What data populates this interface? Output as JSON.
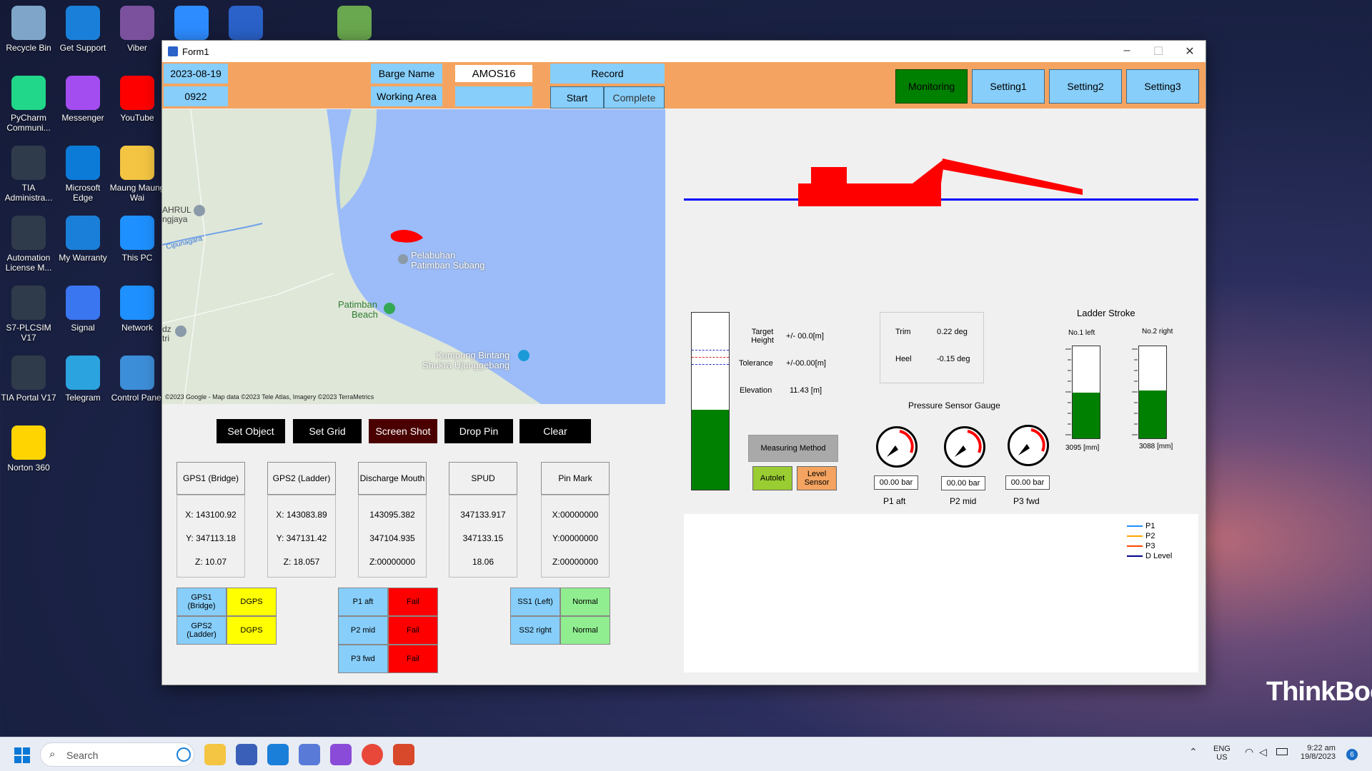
{
  "desktop": {
    "icons": [
      {
        "label": "Recycle Bin",
        "icon": "recycle-bin-icon",
        "color": "#7fa6c8"
      },
      {
        "label": "Get Support",
        "icon": "get-support-icon",
        "color": "#1a7fd8"
      },
      {
        "label": "Viber",
        "icon": "viber-icon",
        "color": "#7b519d"
      },
      {
        "label": "zoom",
        "icon": "zoom-icon",
        "color": "#2d8cff"
      },
      {
        "label": "",
        "icon": "network-tool-icon",
        "color": "#2a62c9"
      },
      {
        "label": "",
        "icon": "notepad-image-icon",
        "color": "#6aa84f"
      },
      {
        "label": "PyCharm Communi...",
        "icon": "pycharm-icon",
        "color": "#21d789"
      },
      {
        "label": "Messenger",
        "icon": "messenger-icon",
        "color": "#a34df0"
      },
      {
        "label": "YouTube",
        "icon": "youtube-icon",
        "color": "#ff0000"
      },
      {
        "label": "TIA Administra...",
        "icon": "tia-admin-icon",
        "color": "#2f3b4a"
      },
      {
        "label": "Microsoft Edge",
        "icon": "edge-icon",
        "color": "#0c7bd8"
      },
      {
        "label": "Maung Maung Wai",
        "icon": "folder-icon",
        "color": "#f4c542"
      },
      {
        "label": "Automation License M...",
        "icon": "license-manager-icon",
        "color": "#2f3b4a"
      },
      {
        "label": "My Warranty",
        "icon": "my-warranty-icon",
        "color": "#1a7fd8"
      },
      {
        "label": "This PC",
        "icon": "this-pc-icon",
        "color": "#1e90ff"
      },
      {
        "label": "S7-PLCSIM V17",
        "icon": "plcsim-icon",
        "color": "#2f3b4a"
      },
      {
        "label": "Signal",
        "icon": "signal-icon",
        "color": "#3a76f0"
      },
      {
        "label": "Network",
        "icon": "network-icon",
        "color": "#1e90ff"
      },
      {
        "label": "TIA Portal V17",
        "icon": "tia-portal-icon",
        "color": "#2f3b4a"
      },
      {
        "label": "Telegram",
        "icon": "telegram-icon",
        "color": "#2aa3df"
      },
      {
        "label": "Control Panel",
        "icon": "control-panel-icon",
        "color": "#3d8ed8"
      },
      {
        "label": "Norton 360",
        "icon": "norton-icon",
        "color": "#ffd400"
      }
    ],
    "brand": "ThinkBook"
  },
  "window": {
    "title": "Form1",
    "controls": {
      "minimize": "–",
      "maximize": "☐",
      "close": "✕"
    }
  },
  "toolbar": {
    "date": "2023-08-19",
    "time": "0922",
    "barge_name_label": "Barge Name",
    "barge_name_value": "AMOS16",
    "working_area_label": "Working Area",
    "working_area_value": "",
    "record_label": "Record",
    "start_label": "Start",
    "complete_label": "Complete",
    "tabs": [
      "Monitoring",
      "Setting1",
      "Setting2",
      "Setting3"
    ]
  },
  "map": {
    "labels": {
      "ahrul": "AHRUL",
      "ngjaya": "ngjaya",
      "cipunagara": "Cipunagara",
      "pelabuhan": "Pelabuhan",
      "patimban_subang": "Patimban Subang",
      "patimban": "Patimban",
      "beach": "Beach",
      "dz": "dz",
      "tri": "tri",
      "kampung": "Kampung Bintang",
      "shukra": "Shukra Ujunggebang"
    },
    "attribution": "©2023 Google - Map data ©2023 Tele Atlas, Imagery ©2023 TerraMetrics"
  },
  "actions": [
    "Set Object",
    "Set Grid",
    "Screen Shot",
    "Drop Pin",
    "Clear"
  ],
  "gps_panels": [
    {
      "title": "GPS1 (Bridge)",
      "l1": "X: 143100.92",
      "l2": "Y: 347113.18",
      "l3": "Z: 10.07"
    },
    {
      "title": "GPS2 (Ladder)",
      "l1": "X: 143083.89",
      "l2": "Y: 347131.42",
      "l3": "Z: 18.057"
    },
    {
      "title": "Discharge Mouth",
      "l1": "143095.382",
      "l2": "347104.935",
      "l3": "Z:00000000"
    },
    {
      "title": "SPUD",
      "l1": "347133.917",
      "l2": "347133.15",
      "l3": "18.06"
    },
    {
      "title": "Pin Mark",
      "l1": "X:00000000",
      "l2": "Y:00000000",
      "l3": "Z:00000000"
    }
  ],
  "status": {
    "gps": [
      {
        "name": "GPS1 (Bridge)",
        "state": "DGPS"
      },
      {
        "name": "GPS2 (Ladder)",
        "state": "DGPS"
      }
    ],
    "pressure": [
      {
        "name": "P1 aft",
        "state": "Fail"
      },
      {
        "name": "P2 mid",
        "state": "Fail"
      },
      {
        "name": "P3 fwd",
        "state": "Fail"
      }
    ],
    "ss": [
      {
        "name": "SS1 (Left)",
        "state": "Normal"
      },
      {
        "name": "SS2 right",
        "state": "Normal"
      }
    ],
    "colors": {
      "blue": "#87cefa",
      "yellow": "#ffff00",
      "red": "#ff0000",
      "green": "#90ee90"
    }
  },
  "level": {
    "fill_fraction": 0.45,
    "target_height_label": "Target Height",
    "target_height_value": "+/- 00.0[m]",
    "tolerance_label": "Tolerance",
    "tolerance_value": "+/-00.00[m]",
    "elevation_label": "Elevation",
    "elevation_value": "11.43 [m]"
  },
  "trim_heel": {
    "trim_label": "Trim",
    "trim_value": "0.22 deg",
    "heel_label": "Heel",
    "heel_value": "-0.15 deg"
  },
  "measuring": {
    "title": "Measuring Method",
    "autolet": "Autolet",
    "level_sensor": "Level Sensor"
  },
  "pressure_gauges": {
    "title": "Pressure Sensor Gauge",
    "gauges": [
      {
        "label": "P1 aft",
        "value": "00.00 bar"
      },
      {
        "label": "P2 mid",
        "value": "00.00 bar"
      },
      {
        "label": "P3 fwd",
        "value": "00.00 bar"
      }
    ]
  },
  "ladder_stroke": {
    "title": "Ladder Stroke",
    "left": {
      "label": "No.1 left",
      "value": "3095 [mm]",
      "fill_fraction": 0.5
    },
    "right": {
      "label": "No.2 right",
      "value": "3088 [mm]",
      "fill_fraction": 0.52
    }
  },
  "chart_data": {
    "type": "line",
    "series": [
      {
        "name": "P1",
        "color": "#1e90ff",
        "values": []
      },
      {
        "name": "P2",
        "color": "#ffa500",
        "values": []
      },
      {
        "name": "P3",
        "color": "#ff4500",
        "values": []
      },
      {
        "name": "D Level",
        "color": "#00008b",
        "values": []
      }
    ],
    "legend": "top-right"
  },
  "taskbar": {
    "search_placeholder": "Search",
    "lang1": "ENG",
    "lang2": "US",
    "time": "9:22 am",
    "date": "19/8/2023",
    "badge": "6"
  }
}
